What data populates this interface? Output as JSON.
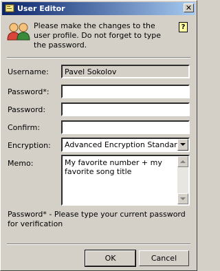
{
  "window": {
    "title": "User Editor",
    "close_label": "✕"
  },
  "intro": "Please make the changes to the user profile. Do not forget to type the password.",
  "help": {
    "label": "?"
  },
  "form": {
    "username": {
      "label": "Username:",
      "value": "Pavel Sokolov"
    },
    "current_password": {
      "label": "Password*:",
      "value": ""
    },
    "password": {
      "label": "Password:",
      "value": ""
    },
    "confirm": {
      "label": "Confirm:",
      "value": ""
    },
    "encryption": {
      "label": "Encryption:",
      "value": "Advanced Encryption Standart"
    },
    "memo": {
      "label": "Memo:",
      "value": "My favorite number + my favorite song title"
    }
  },
  "note": "Password* - Please type your current password for verification",
  "buttons": {
    "ok": "OK",
    "cancel": "Cancel"
  }
}
